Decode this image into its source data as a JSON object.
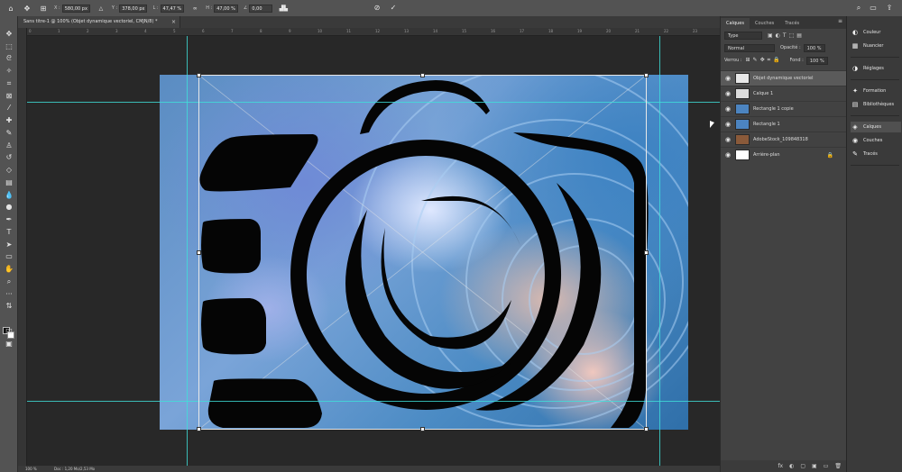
{
  "options_bar": {
    "x_label": "X :",
    "x_value": "580,00 px",
    "y_label": "Y :",
    "y_value": "378,00 px",
    "w_label": "L :",
    "w_value": "47,47 %",
    "h_label": "H :",
    "h_value": "47,00 %",
    "angle_label": "∠",
    "angle_value": "0,00",
    "interp_label": "▟▙"
  },
  "document_tab": {
    "title": "Sans titre-1 @ 100% (Objet dynamique vectoriel, CMJN/8) *",
    "close": "×"
  },
  "status": {
    "zoom": "100 %",
    "doc_info": "Doc : 1,20 Mo/2,53 Mo"
  },
  "ruler_ticks": [
    "0",
    "1",
    "2",
    "3",
    "4",
    "5",
    "6",
    "7",
    "8",
    "9",
    "10",
    "11",
    "12",
    "13",
    "14",
    "15",
    "16",
    "17",
    "18",
    "19",
    "20",
    "21",
    "22",
    "23"
  ],
  "layers_panel": {
    "tabs": [
      "Calques",
      "Couches",
      "Tracés"
    ],
    "active_tab": "Calques",
    "kind_placeholder": "Type",
    "blend_mode": "Normal",
    "opacity_label": "Opacité :",
    "opacity_value": "100 %",
    "lock_label": "Verrou :",
    "fill_label": "Fond :",
    "fill_value": "100 %",
    "layers": [
      {
        "name": "Objet dynamique vectoriel",
        "selected": true,
        "thumb": "#e8e8e8"
      },
      {
        "name": "Calque 1",
        "selected": false,
        "thumb": "#dcdcdc"
      },
      {
        "name": "Rectangle 1 copie",
        "selected": false,
        "thumb": "#4c84c0"
      },
      {
        "name": "Rectangle 1",
        "selected": false,
        "thumb": "#4c84c0"
      },
      {
        "name": "AdobeStock_109848318",
        "selected": false,
        "thumb": "#8a5a3a"
      },
      {
        "name": "Arrière-plan",
        "selected": false,
        "thumb": "#ffffff",
        "locked": true
      }
    ],
    "footer_icons": [
      "fx",
      "◐",
      "▢",
      "▣",
      "▭",
      "🗑"
    ]
  },
  "dock": {
    "group1": [
      {
        "icon": "◐",
        "label": "Couleur"
      },
      {
        "icon": "▦",
        "label": "Nuancier"
      }
    ],
    "group2": [
      {
        "icon": "◑",
        "label": "Réglages"
      }
    ],
    "group3": [
      {
        "icon": "✦",
        "label": "Formation"
      },
      {
        "icon": "▤",
        "label": "Bibliothèques"
      }
    ],
    "group4": [
      {
        "icon": "◈",
        "label": "Calques",
        "active": true
      },
      {
        "icon": "◉",
        "label": "Couches"
      },
      {
        "icon": "✎",
        "label": "Tracés"
      }
    ]
  },
  "colors": {
    "guide": "#3ee0d9",
    "panel": "#424242",
    "toolbar": "#535353",
    "selected_layer": "#5a5a5a"
  }
}
